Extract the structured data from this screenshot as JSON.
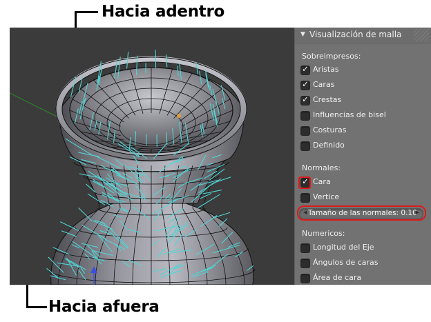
{
  "callouts": {
    "top": "Hacia adentro",
    "bottom": "Hacia afuera"
  },
  "panel": {
    "title": "Visualización de malla",
    "overlays_heading": "Sobreimpresos:",
    "overlays": [
      {
        "label": "Aristas",
        "checked": true
      },
      {
        "label": "Caras",
        "checked": true
      },
      {
        "label": "Crestas",
        "checked": true
      },
      {
        "label": "Influencias de bisel",
        "checked": false
      },
      {
        "label": "Costuras",
        "checked": false
      },
      {
        "label": "Definido",
        "checked": false
      }
    ],
    "normals_heading": "Normales:",
    "normals": [
      {
        "label": "Cara",
        "checked": true
      },
      {
        "label": "Vertice",
        "checked": false
      }
    ],
    "normal_size_label": "Tamaño de las normales: 0.10",
    "numerics_heading": "Numericos:",
    "numerics": [
      {
        "label": "Longitud del Eje",
        "checked": false
      },
      {
        "label": "Ángulos de caras",
        "checked": false
      },
      {
        "label": "Área de cara",
        "checked": false
      }
    ]
  },
  "colors": {
    "normals": "#4fd6d6",
    "highlight": "#e01818",
    "viewport_bg": "#3b3b3b",
    "panel_bg": "#727272"
  }
}
